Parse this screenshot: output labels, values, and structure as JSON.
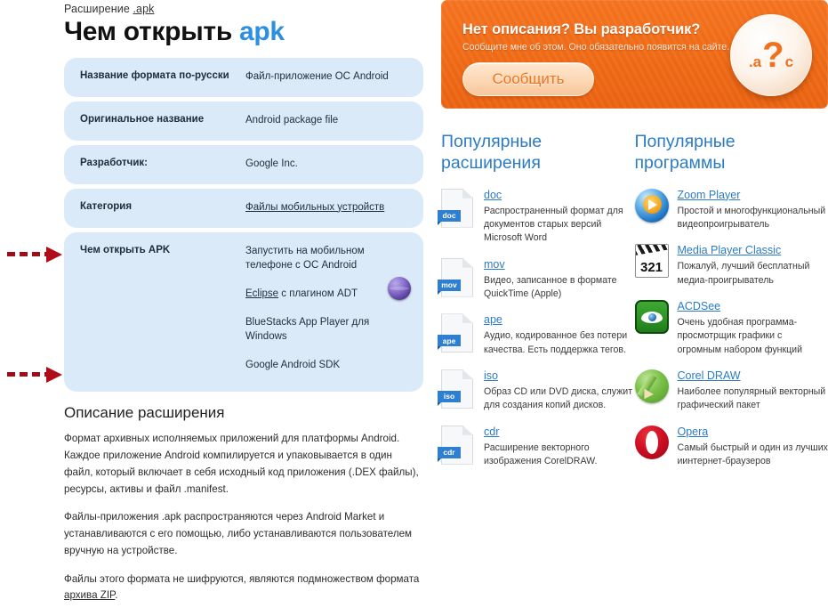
{
  "breadcrumb": {
    "prefix": "Расширение",
    "link": ".apk"
  },
  "title": {
    "lead": "Чем открыть",
    "ext": "apk"
  },
  "info_rows": [
    {
      "key": "Название формата по-русски",
      "value": "Файл-приложение ОС Android",
      "is_link": false
    },
    {
      "key": "Оригинальное название",
      "value": "Android package file",
      "is_link": false
    },
    {
      "key": "Разработчик:",
      "value": "Google Inc.",
      "is_link": false
    },
    {
      "key": "Категория",
      "value": "Файлы мобильных устройств",
      "is_link": true
    }
  ],
  "open_with": {
    "key": "Чем открыть APK",
    "lines": [
      "Запустить на мобильном телефоне с ОС Android",
      "Eclipse с плагином ADT",
      "BlueStacks App Player для Windows",
      "Google Android SDK"
    ],
    "link_text": "Eclipse",
    "link_tail": " с плагином ADT"
  },
  "description": {
    "heading": "Описание расширения",
    "paragraphs": [
      "Формат архивных исполняемых приложений для платформы Android. Каждое приложение Android компилируется и упаковывается в один файл, который включает в себя исходный код приложения (.DEX файлы), ресурсы, активы и файл .manifest.",
      "Файлы-приложения .apk распространяются через Android Market и устанавливаются с его помощью, либо устанавливаются пользователем вручную на устройстве."
    ],
    "last_paragraph_lead": "Файлы этого формата не шифруются, являются подмножеством формата ",
    "last_paragraph_link": "архива ZIP",
    "last_paragraph_tail": "."
  },
  "banner": {
    "heading": "Нет описания? Вы разработчик?",
    "subtext": "Сообщите мне об этом. Оно обязательно появится на сайте.",
    "button": "Сообщить",
    "logo_left": ".a",
    "logo_mark": "?",
    "logo_right": "c",
    "bg_color": "#ef6b16",
    "button_text_color": "#ef7420"
  },
  "columns": {
    "extensions": {
      "heading": "Популярные расширения",
      "items": [
        {
          "name": "doc",
          "tag": "doc",
          "desc": "Распространенный формат для документов старых версий Microsoft Word"
        },
        {
          "name": "mov",
          "tag": "mov",
          "desc": "Видео, записанное в формате QuickTime (Apple)"
        },
        {
          "name": "ape",
          "tag": "ape",
          "desc": "Аудио, кодированное без потери качества. Есть поддержка тегов."
        },
        {
          "name": "iso",
          "tag": "iso",
          "desc": "Образ CD или DVD диска, служит для создания копий дисков."
        },
        {
          "name": "cdr",
          "tag": "cdr",
          "desc": "Расширение векторного изображения CorelDRAW."
        }
      ]
    },
    "programs": {
      "heading": "Популярные программы",
      "items": [
        {
          "name": "Zoom Player",
          "icon": "zoom-player-icon",
          "desc": "Простой и многофункциональный видеопроигрыватель"
        },
        {
          "name": "Media Player Classic",
          "icon": "media-player-classic-icon",
          "desc": "Пожалуй, лучший бесплатный медиа-проигрыватель",
          "badge": "321"
        },
        {
          "name": "ACDSee",
          "icon": "acdsee-icon",
          "desc": "Очень удобная программа-просмотрщик графики с огромным набором функций"
        },
        {
          "name": "Corel DRAW",
          "icon": "corel-draw-icon",
          "desc": "Наиболее популярный векторный графический пакет"
        },
        {
          "name": "Opera",
          "icon": "opera-icon",
          "desc": "Самый быстрый и один из лучших иинтернет-браузеров"
        }
      ]
    }
  },
  "link_color": "#2b7cc4"
}
